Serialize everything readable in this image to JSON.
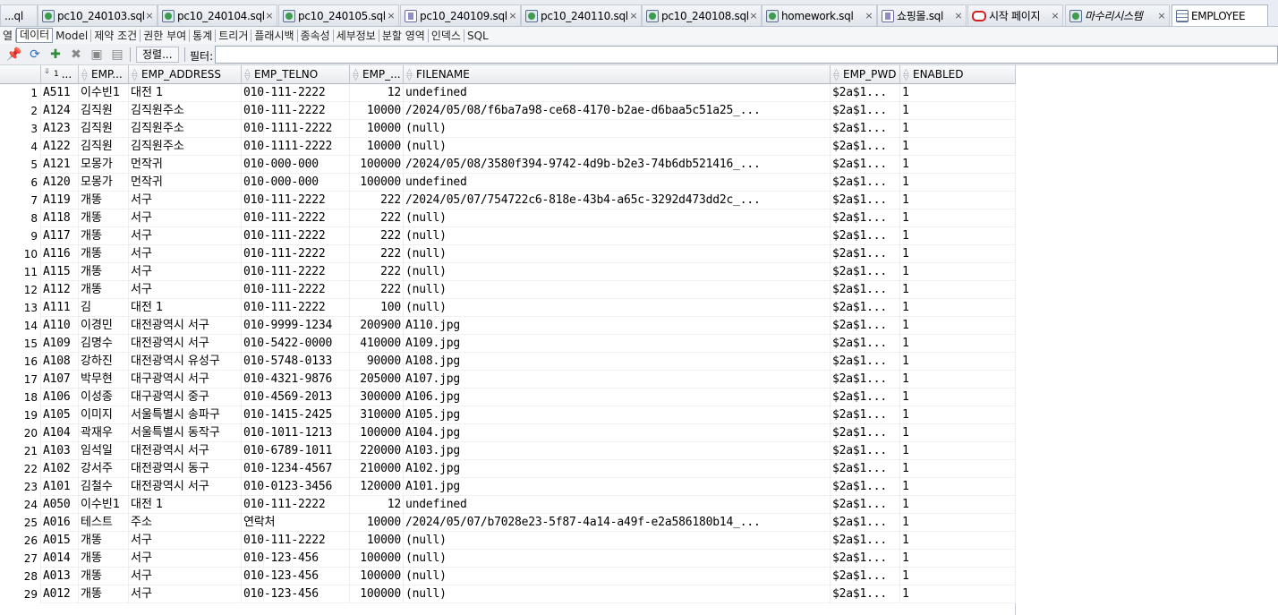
{
  "tabs": [
    {
      "label": "...ql",
      "icon": "sql-file-icon",
      "type": "",
      "italic": false,
      "active": false,
      "closable": false
    },
    {
      "label": "pc10_240103.sql",
      "icon": "sql-file-icon",
      "type": "sql",
      "italic": false,
      "active": false,
      "closable": true
    },
    {
      "label": "pc10_240104.sql",
      "icon": "sql-file-icon",
      "type": "sql",
      "italic": false,
      "active": false,
      "closable": true
    },
    {
      "label": "pc10_240105.sql",
      "icon": "sql-file-icon",
      "type": "sql",
      "italic": false,
      "active": false,
      "closable": true
    },
    {
      "label": "pc10_240109.sql",
      "icon": "package-file-icon",
      "type": "pkg",
      "italic": false,
      "active": false,
      "closable": true
    },
    {
      "label": "pc10_240110.sql",
      "icon": "sql-file-icon",
      "type": "sql",
      "italic": false,
      "active": false,
      "closable": true
    },
    {
      "label": "pc10_240108.sql",
      "icon": "sql-file-icon",
      "type": "sql",
      "italic": false,
      "active": false,
      "closable": true
    },
    {
      "label": "homework.sql",
      "icon": "sql-file-icon",
      "type": "sql",
      "italic": false,
      "active": false,
      "closable": true
    },
    {
      "label": "쇼핑몰.sql",
      "icon": "package-file-icon",
      "type": "pkg",
      "italic": false,
      "active": false,
      "closable": true
    },
    {
      "label": "시작 페이지",
      "icon": "start-page-icon",
      "type": "start",
      "italic": false,
      "active": false,
      "closable": true
    },
    {
      "label": "마수리시스템",
      "icon": "sql-file-icon",
      "type": "sql",
      "italic": true,
      "active": false,
      "closable": true
    },
    {
      "label": "EMPLOYEE",
      "icon": "table-icon",
      "type": "table",
      "italic": false,
      "active": true,
      "closable": false
    }
  ],
  "subtabs": [
    {
      "label": "열",
      "active": false
    },
    {
      "label": "데이터",
      "active": true
    },
    {
      "label": "Model",
      "active": false
    },
    {
      "label": "제약 조건",
      "active": false
    },
    {
      "label": "권한 부여",
      "active": false
    },
    {
      "label": "통계",
      "active": false
    },
    {
      "label": "트리거",
      "active": false
    },
    {
      "label": "플래시백",
      "active": false
    },
    {
      "label": "종속성",
      "active": false
    },
    {
      "label": "세부정보",
      "active": false
    },
    {
      "label": "분할 영역",
      "active": false
    },
    {
      "label": "인덱스",
      "active": false
    },
    {
      "label": "SQL",
      "active": false
    }
  ],
  "toolbar": {
    "sort_label": "정렬...",
    "filter_label": "필터:",
    "filter_value": ""
  },
  "columns": [
    "EMP...",
    "EMP_ADDRESS",
    "EMP_TELNO",
    "EMP_...",
    "FILENAME",
    "EMP_PWD",
    "ENABLED"
  ],
  "first_column": {
    "sort_indicator": "1",
    "label": "..."
  },
  "rows": [
    [
      1,
      "A511",
      "이수빈1",
      "대전 1",
      "010-111-2222",
      "12",
      "undefined",
      "$2a$1...",
      "1"
    ],
    [
      2,
      "A124",
      "김직원",
      "김직원주소",
      "010-111-2222",
      "10000",
      "/2024/05/08/f6ba7a98-ce68-4170-b2ae-d6baa5c51a25_...",
      "$2a$1...",
      "1"
    ],
    [
      3,
      "A123",
      "김직원",
      "김직원주소",
      "010-1111-2222",
      "10000",
      "(null)",
      "$2a$1...",
      "1"
    ],
    [
      4,
      "A122",
      "김직원",
      "김직원주소",
      "010-1111-2222",
      "10000",
      "(null)",
      "$2a$1...",
      "1"
    ],
    [
      5,
      "A121",
      "모몽가",
      "먼작귀",
      "010-000-000",
      "100000",
      "/2024/05/08/3580f394-9742-4d9b-b2e3-74b6db521416_...",
      "$2a$1...",
      "1"
    ],
    [
      6,
      "A120",
      "모몽가",
      "먼작귀",
      "010-000-000",
      "100000",
      "undefined",
      "$2a$1...",
      "1"
    ],
    [
      7,
      "A119",
      "개똥",
      "서구",
      "010-111-2222",
      "222",
      "/2024/05/07/754722c6-818e-43b4-a65c-3292d473dd2c_...",
      "$2a$1...",
      "1"
    ],
    [
      8,
      "A118",
      "개똥",
      "서구",
      "010-111-2222",
      "222",
      "(null)",
      "$2a$1...",
      "1"
    ],
    [
      9,
      "A117",
      "개똥",
      "서구",
      "010-111-2222",
      "222",
      "(null)",
      "$2a$1...",
      "1"
    ],
    [
      10,
      "A116",
      "개똥",
      "서구",
      "010-111-2222",
      "222",
      "(null)",
      "$2a$1...",
      "1"
    ],
    [
      11,
      "A115",
      "개똥",
      "서구",
      "010-111-2222",
      "222",
      "(null)",
      "$2a$1...",
      "1"
    ],
    [
      12,
      "A112",
      "개똥",
      "서구",
      "010-111-2222",
      "222",
      "(null)",
      "$2a$1...",
      "1"
    ],
    [
      13,
      "A111",
      "김",
      "대전 1",
      "010-111-2222",
      "100",
      "(null)",
      "$2a$1...",
      "1"
    ],
    [
      14,
      "A110",
      "이경민",
      "대전광역시 서구",
      "010-9999-1234",
      "200900",
      "A110.jpg",
      "$2a$1...",
      "1"
    ],
    [
      15,
      "A109",
      "김명수",
      "대전광역시 서구",
      "010-5422-0000",
      "410000",
      "A109.jpg",
      "$2a$1...",
      "1"
    ],
    [
      16,
      "A108",
      "강하진",
      "대전광역시 유성구",
      "010-5748-0133",
      "90000",
      "A108.jpg",
      "$2a$1...",
      "1"
    ],
    [
      17,
      "A107",
      "박무현",
      "대구광역시 서구",
      "010-4321-9876",
      "205000",
      "A107.jpg",
      "$2a$1...",
      "1"
    ],
    [
      18,
      "A106",
      "이성종",
      "대구광역시 중구",
      "010-4569-2013",
      "300000",
      "A106.jpg",
      "$2a$1...",
      "1"
    ],
    [
      19,
      "A105",
      "이미지",
      "서울특별시 송파구",
      "010-1415-2425",
      "310000",
      "A105.jpg",
      "$2a$1...",
      "1"
    ],
    [
      20,
      "A104",
      "곽재우",
      "서울특별시 동작구",
      "010-1011-1213",
      "100000",
      "A104.jpg",
      "$2a$1...",
      "1"
    ],
    [
      21,
      "A103",
      "임석일",
      "대전광역시 서구",
      "010-6789-1011",
      "220000",
      "A103.jpg",
      "$2a$1...",
      "1"
    ],
    [
      22,
      "A102",
      "강서주",
      "대전광역시 동구",
      "010-1234-4567",
      "210000",
      "A102.jpg",
      "$2a$1...",
      "1"
    ],
    [
      23,
      "A101",
      "김철수",
      "대전광역시 서구",
      "010-0123-3456",
      "120000",
      "A101.jpg",
      "$2a$1...",
      "1"
    ],
    [
      24,
      "A050",
      "이수빈1",
      "대전 1",
      "010-111-2222",
      "12",
      "undefined",
      "$2a$1...",
      "1"
    ],
    [
      25,
      "A016",
      "테스트",
      "주소",
      "연락처",
      "10000",
      "/2024/05/07/b7028e23-5f87-4a14-a49f-e2a586180b14_...",
      "$2a$1...",
      "1"
    ],
    [
      26,
      "A015",
      "개똥",
      "서구",
      "010-111-2222",
      "10000",
      "(null)",
      "$2a$1...",
      "1"
    ],
    [
      27,
      "A014",
      "개똥",
      "서구",
      "010-123-456",
      "100000",
      "(null)",
      "$2a$1...",
      "1"
    ],
    [
      28,
      "A013",
      "개똥",
      "서구",
      "010-123-456",
      "100000",
      "(null)",
      "$2a$1...",
      "1"
    ],
    [
      29,
      "A012",
      "개똥",
      "서구",
      "010-123-456",
      "100000",
      "(null)",
      "$2a$1...",
      "1"
    ]
  ]
}
